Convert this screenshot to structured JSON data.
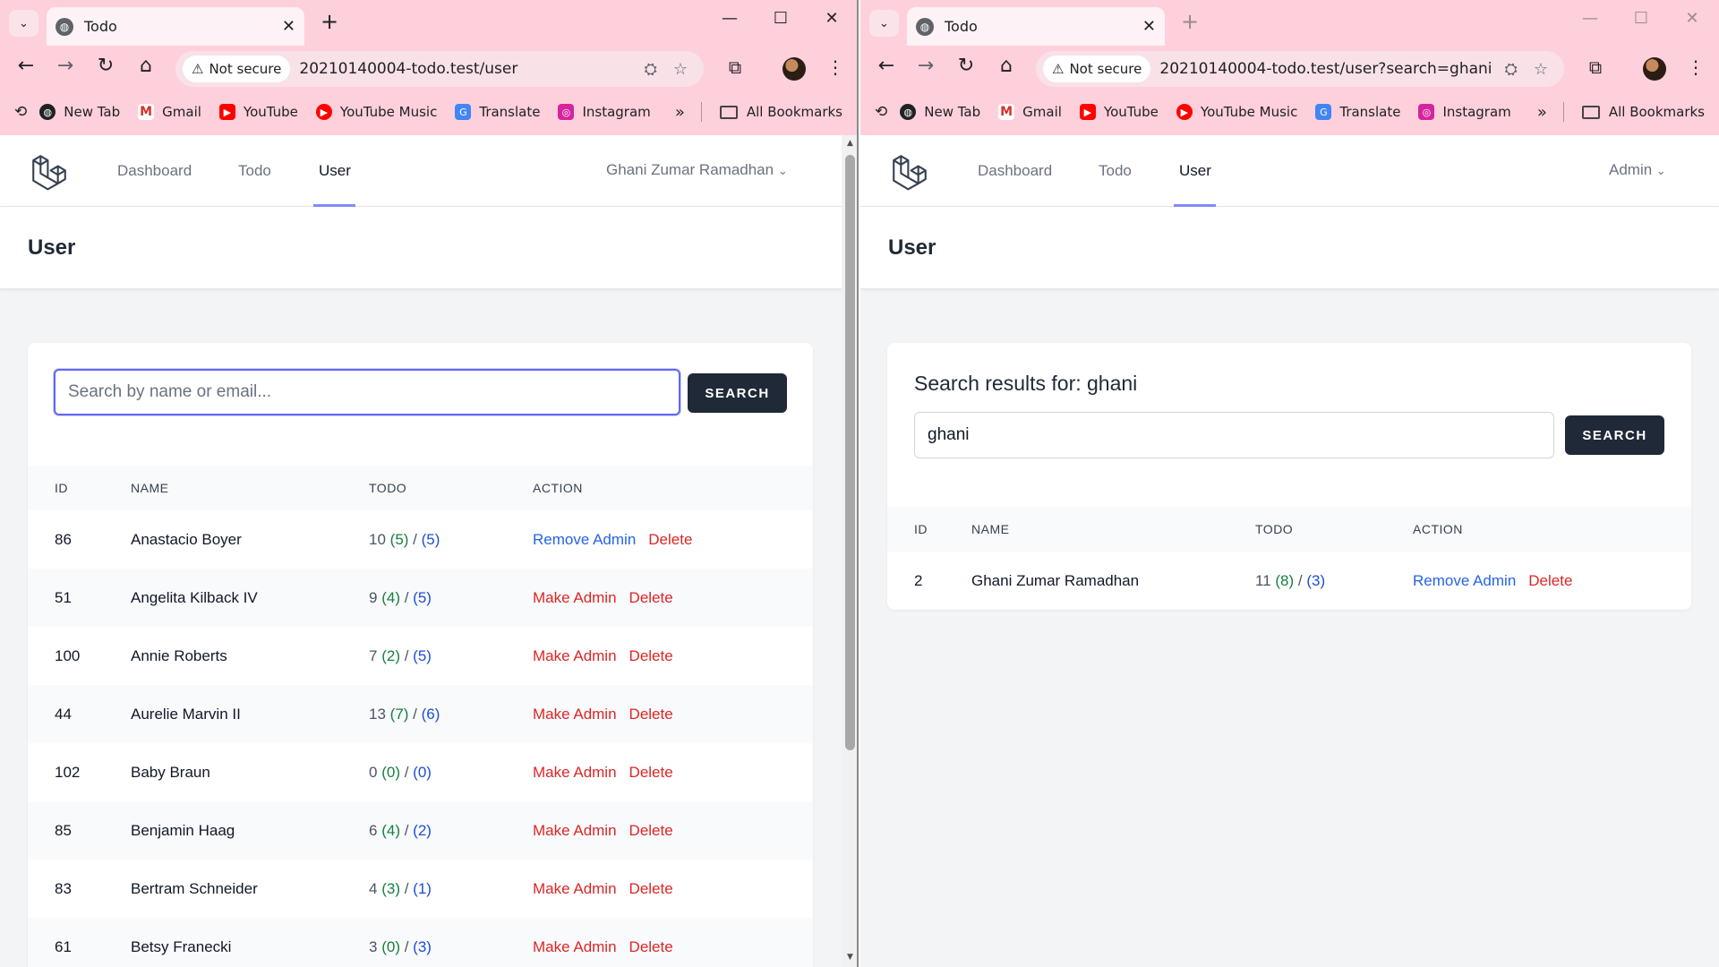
{
  "left": {
    "tab_title": "Todo",
    "omnibox": {
      "security": "Not secure",
      "url": "20210140004-todo.test/user"
    },
    "bookmarks": [
      "New Tab",
      "Gmail",
      "YouTube",
      "YouTube Music",
      "Translate",
      "Instagram"
    ],
    "all_bookmarks": "All Bookmarks",
    "nav": {
      "dashboard": "Dashboard",
      "todo": "Todo",
      "user": "User",
      "user_menu": "Ghani Zumar Ramadhan"
    },
    "page_title": "User",
    "search": {
      "placeholder": "Search by name or email...",
      "button": "SEARCH"
    },
    "table": {
      "headers": [
        "ID",
        "NAME",
        "TODO",
        "ACTION"
      ],
      "rows": [
        {
          "id": "86",
          "name": "Anastacio Boyer",
          "total": "10",
          "done": "(5)",
          "pending": "(5)",
          "toggle": "Remove Admin",
          "toggle_kind": "remove",
          "delete": "Delete"
        },
        {
          "id": "51",
          "name": "Angelita Kilback IV",
          "total": "9",
          "done": "(4)",
          "pending": "(5)",
          "toggle": "Make Admin",
          "toggle_kind": "make",
          "delete": "Delete"
        },
        {
          "id": "100",
          "name": "Annie Roberts",
          "total": "7",
          "done": "(2)",
          "pending": "(5)",
          "toggle": "Make Admin",
          "toggle_kind": "make",
          "delete": "Delete"
        },
        {
          "id": "44",
          "name": "Aurelie Marvin II",
          "total": "13",
          "done": "(7)",
          "pending": "(6)",
          "toggle": "Make Admin",
          "toggle_kind": "make",
          "delete": "Delete"
        },
        {
          "id": "102",
          "name": "Baby Braun",
          "total": "0",
          "done": "(0)",
          "pending": "(0)",
          "toggle": "Make Admin",
          "toggle_kind": "make",
          "delete": "Delete"
        },
        {
          "id": "85",
          "name": "Benjamin Haag",
          "total": "6",
          "done": "(4)",
          "pending": "(2)",
          "toggle": "Make Admin",
          "toggle_kind": "make",
          "delete": "Delete"
        },
        {
          "id": "83",
          "name": "Bertram Schneider",
          "total": "4",
          "done": "(3)",
          "pending": "(1)",
          "toggle": "Make Admin",
          "toggle_kind": "make",
          "delete": "Delete"
        },
        {
          "id": "61",
          "name": "Betsy Franecki",
          "total": "3",
          "done": "(0)",
          "pending": "(3)",
          "toggle": "Make Admin",
          "toggle_kind": "make",
          "delete": "Delete"
        }
      ]
    }
  },
  "right": {
    "tab_title": "Todo",
    "omnibox": {
      "security": "Not secure",
      "url": "20210140004-todo.test/user?search=ghani"
    },
    "bookmarks": [
      "New Tab",
      "Gmail",
      "YouTube",
      "YouTube Music",
      "Translate",
      "Instagram"
    ],
    "all_bookmarks": "All Bookmarks",
    "nav": {
      "dashboard": "Dashboard",
      "todo": "Todo",
      "user": "User",
      "user_menu": "Admin"
    },
    "page_title": "User",
    "search": {
      "results_title": "Search results for: ghani",
      "value": "ghani",
      "button": "SEARCH"
    },
    "table": {
      "headers": [
        "ID",
        "NAME",
        "TODO",
        "ACTION"
      ],
      "rows": [
        {
          "id": "2",
          "name": "Ghani Zumar Ramadhan",
          "total": "11",
          "done": "(8)",
          "pending": "(3)",
          "toggle": "Remove Admin",
          "toggle_kind": "remove",
          "delete": "Delete"
        }
      ]
    }
  },
  "colors": {
    "chrome": "#fdd0db",
    "done": "#15803d",
    "pending": "#1d4ed8",
    "remove_admin": "#2563eb",
    "make_admin": "#dc2626",
    "button": "#1f2937",
    "focus": "#6366f1"
  },
  "icons": {
    "bookmarks": [
      "globe-icon",
      "gmail-icon",
      "youtube-icon",
      "youtube-music-icon",
      "translate-icon",
      "instagram-icon"
    ]
  }
}
